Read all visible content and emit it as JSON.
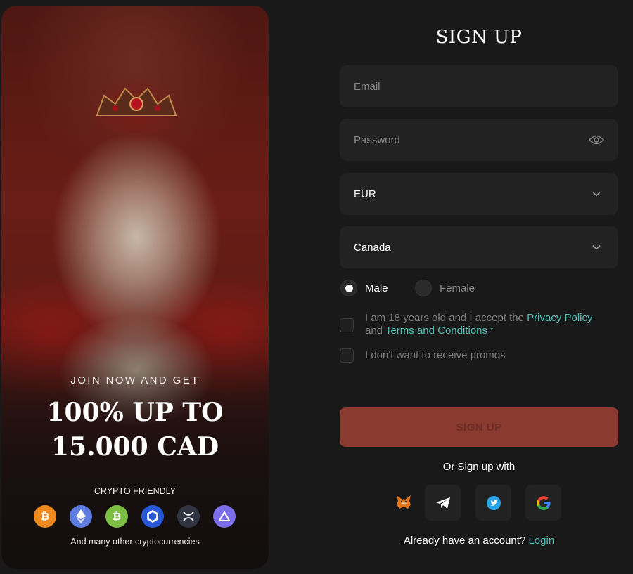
{
  "promo": {
    "join_text": "JOIN NOW AND GET",
    "bonus_line1": "100% UP TO",
    "bonus_line2": "15.000 CAD",
    "crypto_title": "CRYPTO FRIENDLY",
    "crypto_icons": [
      "bitcoin-icon",
      "ethereum-icon",
      "bitcoin-cash-icon",
      "chainlink-icon",
      "ripple-icon",
      "tron-icon"
    ],
    "crypto_more": "And many other cryptocurrencies"
  },
  "form": {
    "title": "SIGN UP",
    "email_placeholder": "Email",
    "email_value": "",
    "password_placeholder": "Password",
    "password_value": "",
    "currency": "EUR",
    "country": "Canada",
    "gender": {
      "male_label": "Male",
      "female_label": "Female",
      "selected": "Male"
    },
    "terms": {
      "prefix": "I am 18 years old and I accept the ",
      "privacy_link": "Privacy Policy",
      "middle": " and ",
      "terms_link": "Terms and Conditions",
      "required_mark": "*",
      "checked": false
    },
    "promos": {
      "label": "I don't want to receive promos",
      "checked": false
    },
    "submit_label": "SIGN UP",
    "or_sign_up_with": "Or Sign up with",
    "social_icons": [
      "metamask-icon",
      "telegram-icon",
      "twitter-icon",
      "google-icon"
    ],
    "login_prompt": "Already have an account?",
    "login_link": "Login"
  },
  "colors": {
    "background": "#191919",
    "field_bg": "#222222",
    "accent_link": "#4fc1b8",
    "submit_bg": "#8a3a2e"
  }
}
